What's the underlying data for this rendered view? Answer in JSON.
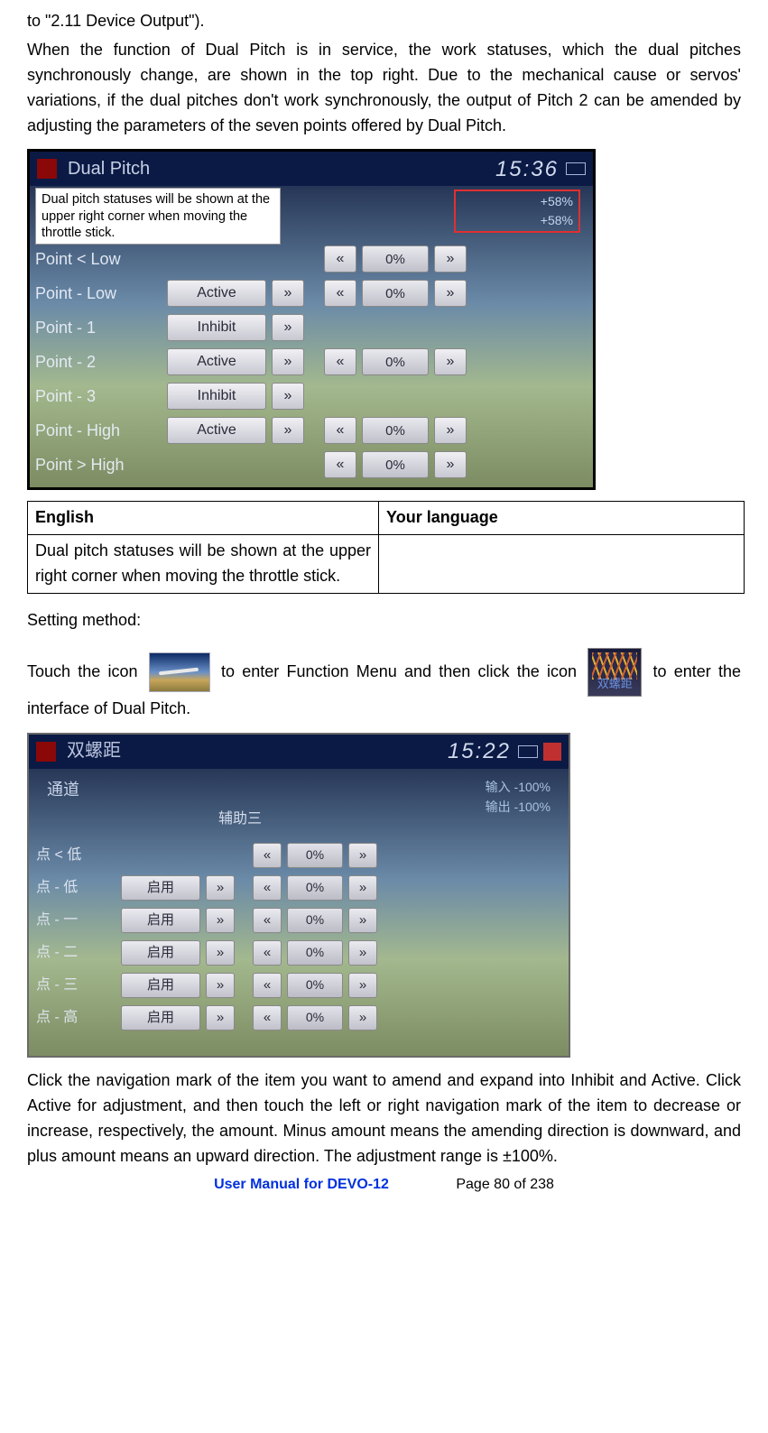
{
  "intro_top": "to \"2.11 Device Output\").",
  "intro_para": "When the function of Dual Pitch is in service, the work statuses, which the dual pitches synchronously change, are shown in the top right. Due to the mechanical cause or servos' variations, if the dual pitches don't work synchronously, the output of Pitch 2 can be amended by adjusting the parameters of the seven points offered by Dual Pitch.",
  "screenshot1": {
    "title": "Dual Pitch",
    "time": "15:36",
    "callout": "Dual pitch statuses will be shown at the upper right corner when moving the throttle stick.",
    "status1": "+58%",
    "status2": "+58%",
    "rows": [
      {
        "label": "Point < Low",
        "state": "",
        "val": "0%"
      },
      {
        "label": "Point - Low",
        "state": "Active",
        "val": "0%"
      },
      {
        "label": "Point - 1",
        "state": "Inhibit",
        "val": ""
      },
      {
        "label": "Point - 2",
        "state": "Active",
        "val": "0%"
      },
      {
        "label": "Point - 3",
        "state": "Inhibit",
        "val": ""
      },
      {
        "label": "Point - High",
        "state": "Active",
        "val": "0%"
      },
      {
        "label": "Point > High",
        "state": "",
        "val": "0%"
      }
    ]
  },
  "table": {
    "h1": "English",
    "h2": "Your language",
    "cell_eng": "Dual pitch statuses will be shown at the upper right corner when moving the throttle stick.",
    "cell_yl": ""
  },
  "setting_method": "Setting method:",
  "touch_1": "Touch the icon",
  "touch_2": "to enter Function Menu and then click the icon",
  "touch_3": "to enter the interface of Dual Pitch.",
  "dual_icon_label": "双螺距",
  "screenshot2": {
    "title": "双螺距",
    "time": "15:22",
    "sub": "通道",
    "sub2": "辅助三",
    "status1": "输入   -100%",
    "status2": "输出   -100%",
    "rows": [
      {
        "label": "点 < 低",
        "state": "",
        "val": "0%"
      },
      {
        "label": "点 - 低",
        "state": "启用",
        "val": "0%"
      },
      {
        "label": "点 - 一",
        "state": "启用",
        "val": "0%"
      },
      {
        "label": "点 - 二",
        "state": "启用",
        "val": "0%"
      },
      {
        "label": "点 - 三",
        "state": "启用",
        "val": "0%"
      },
      {
        "label": "点 - 高",
        "state": "启用",
        "val": "0%"
      }
    ]
  },
  "closing_para": "Click the navigation mark of the item you want to amend and expand into Inhibit and Active. Click Active for adjustment, and then touch the left or right navigation mark of the item to decrease or increase, respectively, the amount. Minus amount means the amending direction is downward, and plus amount means an upward direction. The adjustment range is ±100%.",
  "footer_manual": "User Manual for DEVO-12",
  "footer_page": "Page 80 of 238"
}
